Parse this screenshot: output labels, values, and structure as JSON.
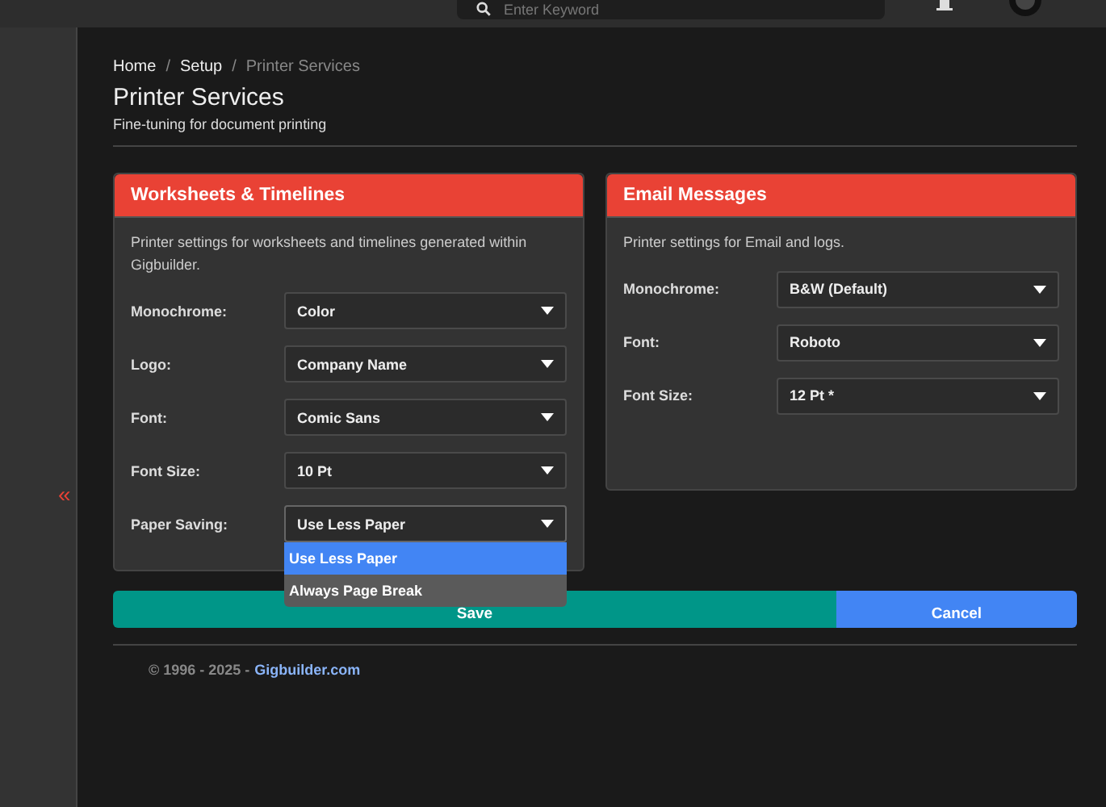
{
  "topbar": {
    "search": {
      "placeholder": "Enter Keyword"
    }
  },
  "sidebar": {
    "collapse_toggle": "«"
  },
  "breadcrumb": {
    "separator": "/",
    "items": [
      {
        "label": "Home",
        "current": false
      },
      {
        "label": "Setup",
        "current": false
      },
      {
        "label": "Printer Services",
        "current": true
      }
    ]
  },
  "page": {
    "title": "Printer Services",
    "subtitle": "Fine-tuning for document printing"
  },
  "cards": [
    {
      "title": "Worksheets & Timelines",
      "description": "Printer settings for worksheets and timelines generated within Gigbuilder.",
      "fields": [
        {
          "label": "Monochrome:",
          "value": "Color",
          "open": false
        },
        {
          "label": "Logo:",
          "value": "Company Name",
          "open": false
        },
        {
          "label": "Font:",
          "value": "Comic Sans",
          "open": false
        },
        {
          "label": "Font Size:",
          "value": "10 Pt",
          "open": false
        },
        {
          "label": "Paper Saving:",
          "value": "Use Less Paper",
          "open": true,
          "options": [
            {
              "label": "Use Less Paper",
              "selected": true
            },
            {
              "label": "Always Page Break",
              "selected": false
            }
          ]
        }
      ]
    },
    {
      "title": "Email Messages",
      "description": "Printer settings for Email and logs.",
      "fields": [
        {
          "label": "Monochrome:",
          "value": "B&W (Default)",
          "open": false
        },
        {
          "label": "Font:",
          "value": "Roboto",
          "open": false
        },
        {
          "label": "Font Size:",
          "value": "12 Pt *",
          "open": false
        }
      ]
    }
  ],
  "buttons": [
    {
      "label": "Save",
      "kind": "save"
    },
    {
      "label": "Cancel",
      "kind": "cancel"
    }
  ],
  "footer": {
    "copyright": "© 1996 - 2025 -",
    "link": "Gigbuilder.com"
  }
}
